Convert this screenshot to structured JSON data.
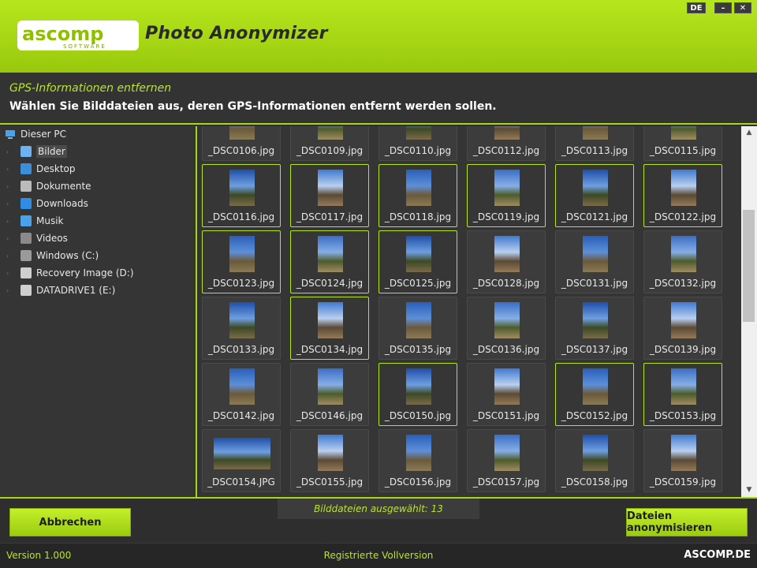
{
  "header": {
    "logo_text": "ascomp",
    "logo_sub": "SOFTWARE",
    "title": "Photo Anonymizer",
    "lang": "DE",
    "minimize_glyph": "–",
    "close_glyph": "✕"
  },
  "instructions": {
    "heading": "GPS-Informationen entfernen",
    "text": "Wählen Sie Bilddateien aus, deren GPS-Informationen entfernt werden sollen."
  },
  "tree": {
    "root": "Dieser PC",
    "items": [
      {
        "label": "Bilder",
        "icon": "pictures-icon",
        "selected": true
      },
      {
        "label": "Desktop",
        "icon": "desktop-icon"
      },
      {
        "label": "Dokumente",
        "icon": "documents-icon"
      },
      {
        "label": "Downloads",
        "icon": "downloads-icon"
      },
      {
        "label": "Musik",
        "icon": "music-icon"
      },
      {
        "label": "Videos",
        "icon": "videos-icon"
      },
      {
        "label": "Windows  (C:)",
        "icon": "windows-drive-icon"
      },
      {
        "label": "Recovery Image (D:)",
        "icon": "drive-icon"
      },
      {
        "label": "DATADRIVE1 (E:)",
        "icon": "drive-icon"
      }
    ]
  },
  "files": [
    {
      "name": "_DSC0106.jpg",
      "selected": false
    },
    {
      "name": "_DSC0109.jpg",
      "selected": false
    },
    {
      "name": "_DSC0110.jpg",
      "selected": false
    },
    {
      "name": "_DSC0112.jpg",
      "selected": false
    },
    {
      "name": "_DSC0113.jpg",
      "selected": false
    },
    {
      "name": "_DSC0115.jpg",
      "selected": false
    },
    {
      "name": "_DSC0116.jpg",
      "selected": true
    },
    {
      "name": "_DSC0117.jpg",
      "selected": true
    },
    {
      "name": "_DSC0118.jpg",
      "selected": true
    },
    {
      "name": "_DSC0119.jpg",
      "selected": true
    },
    {
      "name": "_DSC0121.jpg",
      "selected": true
    },
    {
      "name": "_DSC0122.jpg",
      "selected": true
    },
    {
      "name": "_DSC0123.jpg",
      "selected": true
    },
    {
      "name": "_DSC0124.jpg",
      "selected": true
    },
    {
      "name": "_DSC0125.jpg",
      "selected": true
    },
    {
      "name": "_DSC0128.jpg",
      "selected": false
    },
    {
      "name": "_DSC0131.jpg",
      "selected": false
    },
    {
      "name": "_DSC0132.jpg",
      "selected": false
    },
    {
      "name": "_DSC0133.jpg",
      "selected": false
    },
    {
      "name": "_DSC0134.jpg",
      "selected": true
    },
    {
      "name": "_DSC0135.jpg",
      "selected": false
    },
    {
      "name": "_DSC0136.jpg",
      "selected": false
    },
    {
      "name": "_DSC0137.jpg",
      "selected": false
    },
    {
      "name": "_DSC0139.jpg",
      "selected": false
    },
    {
      "name": "_DSC0142.jpg",
      "selected": false
    },
    {
      "name": "_DSC0146.jpg",
      "selected": false
    },
    {
      "name": "_DSC0150.jpg",
      "selected": true
    },
    {
      "name": "_DSC0151.jpg",
      "selected": false
    },
    {
      "name": "_DSC0152.jpg",
      "selected": true
    },
    {
      "name": "_DSC0153.jpg",
      "selected": true
    },
    {
      "name": "_DSC0154.JPG",
      "selected": false,
      "wide": true
    },
    {
      "name": "_DSC0155.jpg",
      "selected": false
    },
    {
      "name": "_DSC0156.jpg",
      "selected": false
    },
    {
      "name": "_DSC0157.jpg",
      "selected": false
    },
    {
      "name": "_DSC0158.jpg",
      "selected": false
    },
    {
      "name": "_DSC0159.jpg",
      "selected": false
    }
  ],
  "footer": {
    "selected_count": "Bilddateien ausgewählt: 13",
    "cancel_label": "Abbrechen",
    "anonymize_label": "Dateien anonymisieren"
  },
  "status": {
    "version": "Version 1.000",
    "registration": "Registrierte Vollversion",
    "brand": "ASCOMP.DE"
  },
  "colors": {
    "accent": "#b5e61d",
    "accent_text": "#b9e52a",
    "background": "#303030"
  }
}
